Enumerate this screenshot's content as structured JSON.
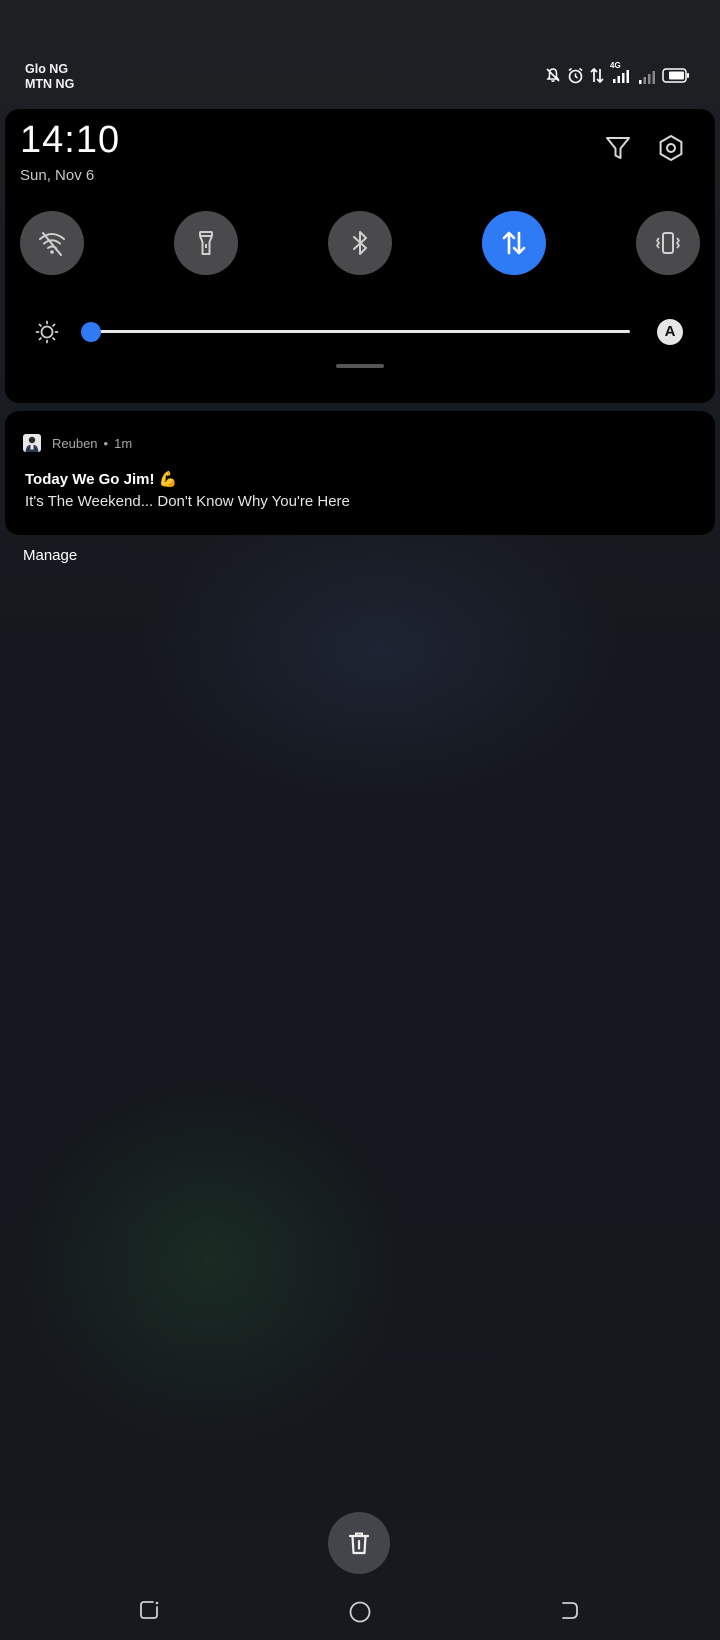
{
  "status_bar": {
    "carriers": [
      "Glo NG",
      "MTN NG"
    ],
    "network_type": "4G",
    "icons": [
      "mute-icon",
      "alarm-icon",
      "data-transfer-icon",
      "signal-4g-icon",
      "signal-icon",
      "battery-icon"
    ]
  },
  "quick_settings": {
    "time": "14:10",
    "date": "Sun, Nov 6",
    "header_icons": [
      "edit-filter-icon",
      "settings-icon"
    ],
    "tiles": [
      {
        "name": "Wi-Fi",
        "icon": "wifi-off-icon",
        "active": false
      },
      {
        "name": "Flashlight",
        "icon": "flashlight-icon",
        "active": false
      },
      {
        "name": "Bluetooth",
        "icon": "bluetooth-icon",
        "active": false
      },
      {
        "name": "Mobile data",
        "icon": "mobile-data-icon",
        "active": true
      },
      {
        "name": "Vibrate",
        "icon": "vibrate-icon",
        "active": false
      }
    ],
    "brightness": {
      "level": 0.0,
      "auto_label": "A"
    },
    "accent_color": "#2f7bf5"
  },
  "notification": {
    "app": "Reuben",
    "time": "1m",
    "separator": "•",
    "title": "Today We Go Jim! 💪",
    "text": "It's The Weekend... Don't Know Why You're Here"
  },
  "manage_label": "Manage",
  "clear_icon": "clear-all-icon",
  "nav_bar": [
    "recents-icon",
    "home-icon",
    "back-icon"
  ]
}
